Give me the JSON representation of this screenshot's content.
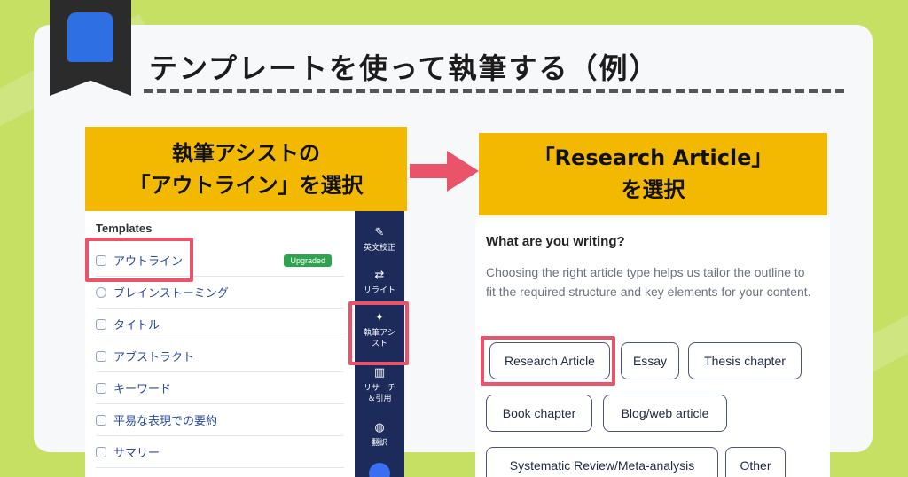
{
  "header": {
    "title": "テンプレートを使って執筆する（例）"
  },
  "steps": {
    "left_line1": "執筆アシストの",
    "left_line2": "「アウトライン」を選択",
    "right_line1": "「Research Article」",
    "right_line2": "を選択"
  },
  "templates": {
    "heading": "Templates",
    "items": [
      {
        "label": "アウトライン",
        "icon": "outline-icon",
        "badge": "Upgraded"
      },
      {
        "label": "ブレインストーミング",
        "icon": "chat-bubble-icon"
      },
      {
        "label": "タイトル",
        "icon": "title-icon"
      },
      {
        "label": "アブストラクト",
        "icon": "document-icon"
      },
      {
        "label": "キーワード",
        "icon": "keyword-icon"
      },
      {
        "label": "平易な表現での要約",
        "icon": "summary-icon"
      },
      {
        "label": "サマリー",
        "icon": "summary-icon"
      }
    ]
  },
  "sidebar": {
    "items": [
      {
        "label": "英文校正",
        "icon": "pen-icon"
      },
      {
        "label": "リライト",
        "icon": "refresh-icon"
      },
      {
        "label": "執筆アシスト",
        "icon": "sparkle-icon"
      },
      {
        "label": "リサーチ＆引用",
        "icon": "books-icon"
      },
      {
        "label": "翻訳",
        "icon": "globe-icon"
      }
    ]
  },
  "writing": {
    "question": "What are you writing?",
    "description": "Choosing the right article type helps us tailor the outline to fit the required structure and key elements for your content.",
    "types": [
      "Research Article",
      "Essay",
      "Thesis chapter",
      "Book chapter",
      "Blog/web article",
      "Systematic Review/Meta-analysis",
      "Other"
    ]
  },
  "colors": {
    "background": "#c5e063",
    "highlight": "#e9546b",
    "callout": "#f3b900",
    "sidebar": "#1c2b5a",
    "logo": "#2f6fe4"
  }
}
